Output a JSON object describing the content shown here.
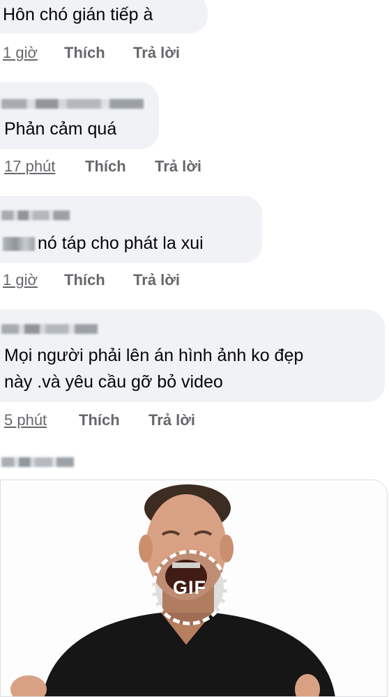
{
  "actions": {
    "like": "Thích",
    "reply": "Trả lời"
  },
  "comments": [
    {
      "text": "Hôn chó gián tiếp à",
      "time": "1 giờ"
    },
    {
      "text": "Phản cảm quá",
      "time": "17 phút"
    },
    {
      "text": "nó táp cho phát la xui",
      "time": "1 giờ"
    },
    {
      "lines": [
        "Mọi người phải lên án hình ảnh ko đẹp",
        "này .và yêu cầu gỡ bỏ video"
      ],
      "time": "5 phút"
    }
  ],
  "gif": {
    "badge": "GIF"
  }
}
